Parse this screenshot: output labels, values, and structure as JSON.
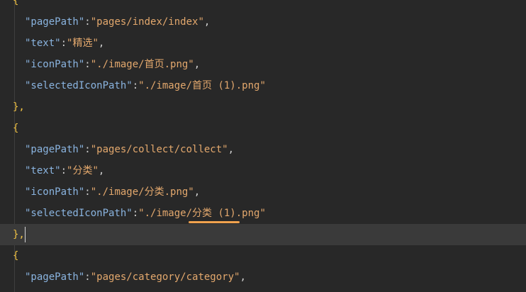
{
  "editor": {
    "lines": [
      {
        "kind": "brace",
        "text": "{",
        "indent": 0
      },
      {
        "kind": "pair",
        "key": "\"pagePath\"",
        "sep": ":",
        "value": "\"pages/index/index\"",
        "comma": ",",
        "indent": 1
      },
      {
        "kind": "pair",
        "key": "\"text\"",
        "sep": ":",
        "value": "\"精选\"",
        "comma": ",",
        "indent": 1
      },
      {
        "kind": "pair",
        "key": "\"iconPath\"",
        "sep": ":",
        "value": "\"./image/首页.png\"",
        "comma": ",",
        "indent": 1
      },
      {
        "kind": "pair",
        "key": "\"selectedIconPath\"",
        "sep": ":",
        "value": "\"./image/首页 (1).png\"",
        "comma": "",
        "indent": 1
      },
      {
        "kind": "brace",
        "text": "},",
        "indent": 0
      },
      {
        "kind": "brace",
        "text": "{",
        "indent": 0
      },
      {
        "kind": "pair",
        "key": "\"pagePath\"",
        "sep": ":",
        "value": "\"pages/collect/collect\"",
        "comma": ",",
        "indent": 1
      },
      {
        "kind": "pair",
        "key": "\"text\"",
        "sep": ":",
        "value": "\"分类\"",
        "comma": ",",
        "indent": 1
      },
      {
        "kind": "pair",
        "key": "\"iconPath\"",
        "sep": ":",
        "value": "\"./image/分类.png\"",
        "comma": ",",
        "indent": 1
      },
      {
        "kind": "pair",
        "key": "\"selectedIconPath\"",
        "sep": ":",
        "value": "\"./image/分类 (1).png\"",
        "comma": "",
        "indent": 1
      },
      {
        "kind": "brace",
        "text": "},",
        "indent": 0,
        "current": true
      },
      {
        "kind": "brace",
        "text": "{",
        "indent": 0
      },
      {
        "kind": "pair",
        "key": "\"pagePath\"",
        "sep": ":",
        "value": "\"pages/category/category\"",
        "comma": ",",
        "indent": 1
      }
    ]
  },
  "colors": {
    "background": "#282828",
    "key": "#8ab4e0",
    "string": "#e3a86d",
    "brace": "#f0c244",
    "current_line": "#3a3a3a",
    "warning_underline": "#f0a24e"
  }
}
